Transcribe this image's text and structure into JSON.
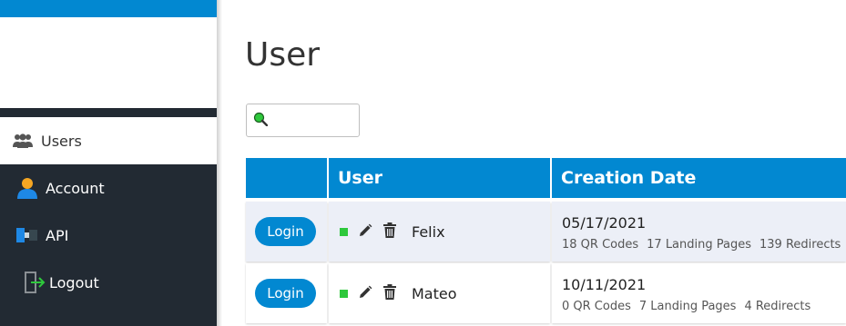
{
  "sidebar": {
    "items": [
      {
        "label": "Users",
        "icon": "users-icon",
        "active": true
      },
      {
        "label": "Account",
        "icon": "account-icon",
        "active": false
      },
      {
        "label": "API",
        "icon": "api-icon",
        "active": false
      },
      {
        "label": "Logout",
        "icon": "logout-icon",
        "active": false
      }
    ]
  },
  "main": {
    "title": "User",
    "search": {
      "value": "",
      "placeholder": ""
    }
  },
  "table": {
    "headers": [
      "",
      "User",
      "Creation Date"
    ],
    "rows": [
      {
        "login_label": "Login",
        "status": "active",
        "name": "Felix",
        "date": "05/17/2021",
        "qr": "18 QR Codes",
        "landing": "17 Landing Pages",
        "redirects": "139 Redirects"
      },
      {
        "login_label": "Login",
        "status": "active",
        "name": "Mateo",
        "date": "10/11/2021",
        "qr": "0 QR Codes",
        "landing": "7 Landing Pages",
        "redirects": "4 Redirects"
      }
    ]
  },
  "colors": {
    "accent": "#0288d1",
    "sidebar_dark": "#222a33",
    "status_active": "#2ec83c",
    "row_alt": "#eceff7"
  }
}
